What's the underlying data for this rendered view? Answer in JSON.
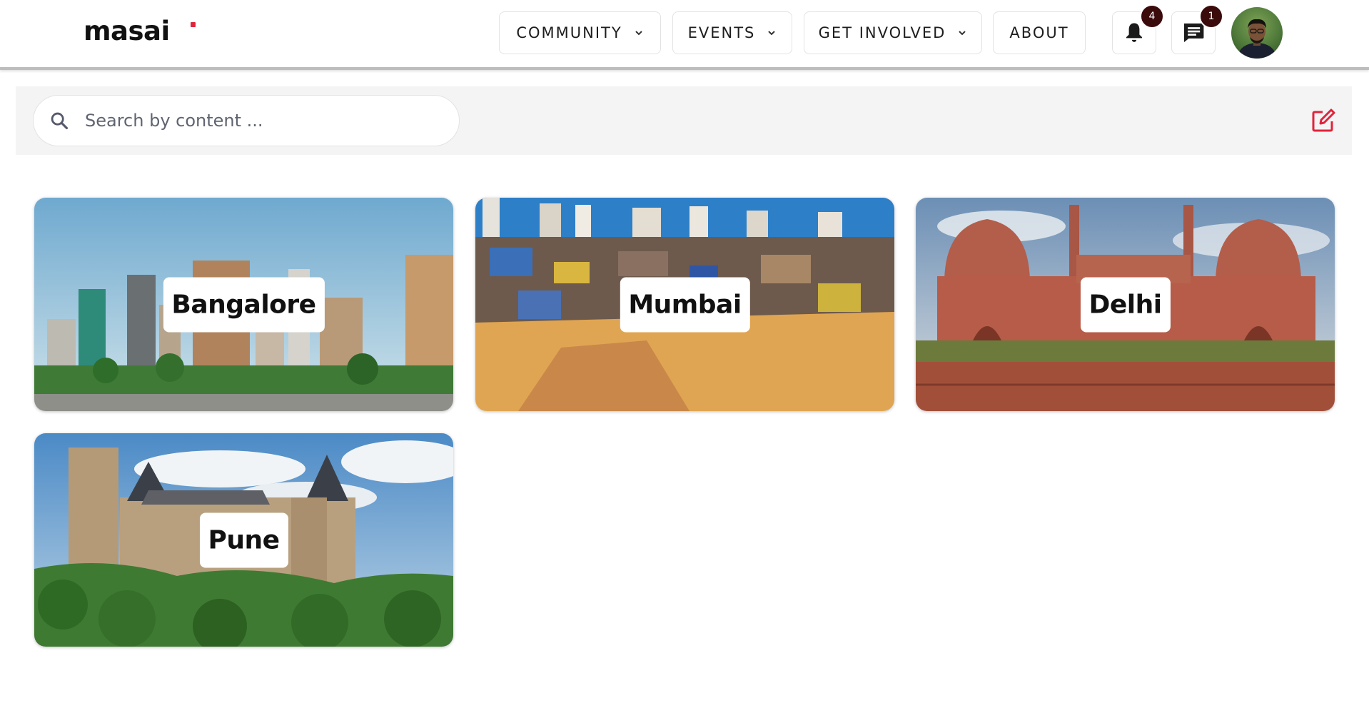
{
  "header": {
    "logo": "masai",
    "nav": [
      {
        "label": "COMMUNITY",
        "has_dropdown": true
      },
      {
        "label": "EVENTS",
        "has_dropdown": true
      },
      {
        "label": "GET INVOLVED",
        "has_dropdown": true
      },
      {
        "label": "ABOUT",
        "has_dropdown": false
      }
    ],
    "notifications": {
      "icon": "bell-icon",
      "count": "4"
    },
    "messages": {
      "icon": "chat-icon",
      "count": "1"
    },
    "avatar": "user-avatar"
  },
  "search": {
    "placeholder": "Search by content ...",
    "value": "",
    "icon": "search-icon",
    "edit_icon": "edit-icon"
  },
  "cities": [
    {
      "name": "Bangalore",
      "scene": "city skyline with glass towers"
    },
    {
      "name": "Mumbai",
      "scene": "dense slum with high-rises behind"
    },
    {
      "name": "Delhi",
      "scene": "red sandstone fort"
    },
    {
      "name": "Pune",
      "scene": "stone castle on forested hill"
    }
  ],
  "colors": {
    "brand_red": "#e0243c",
    "badge_bg": "#3b0a0a",
    "strip_bg": "#f4f4f4"
  }
}
